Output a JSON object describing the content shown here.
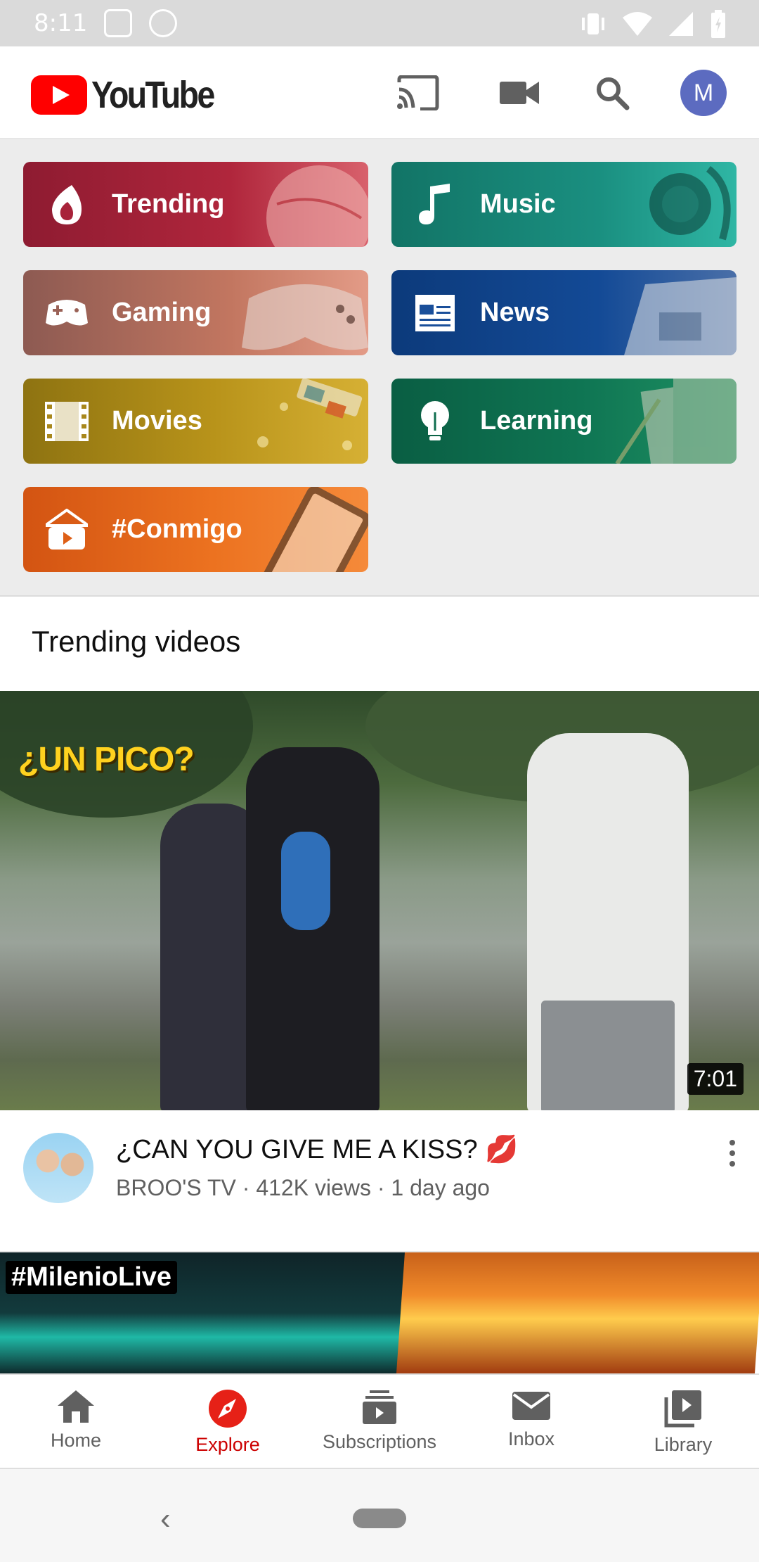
{
  "status_bar": {
    "time": "8:11"
  },
  "app": {
    "logo_text": "YouTube",
    "avatar_letter": "M",
    "brand_color": "#ff0000"
  },
  "categories": [
    {
      "label": "Trending",
      "icon": "flame-icon"
    },
    {
      "label": "Music",
      "icon": "music-note-icon"
    },
    {
      "label": "Gaming",
      "icon": "gamepad-icon"
    },
    {
      "label": "News",
      "icon": "newspaper-icon"
    },
    {
      "label": "Movies",
      "icon": "film-strip-icon"
    },
    {
      "label": "Learning",
      "icon": "lightbulb-icon"
    },
    {
      "label": "#Conmigo",
      "icon": "home-play-icon"
    }
  ],
  "section": {
    "title": "Trending videos"
  },
  "video": {
    "thumbnail_text": "¿UN PICO?",
    "duration": "7:01",
    "title": "¿CAN YOU GIVE ME A KISS? 💋",
    "subtitle": "BROO'S TV · 412K views · 1 day ago"
  },
  "next_video": {
    "tag": "#MilenioLive"
  },
  "bottom_nav": [
    {
      "label": "Home",
      "icon": "home-icon"
    },
    {
      "label": "Explore",
      "icon": "compass-icon",
      "active": true
    },
    {
      "label": "Subscriptions",
      "icon": "subscriptions-icon"
    },
    {
      "label": "Inbox",
      "icon": "mail-icon"
    },
    {
      "label": "Library",
      "icon": "library-icon"
    }
  ],
  "active_color": "#cc0000"
}
